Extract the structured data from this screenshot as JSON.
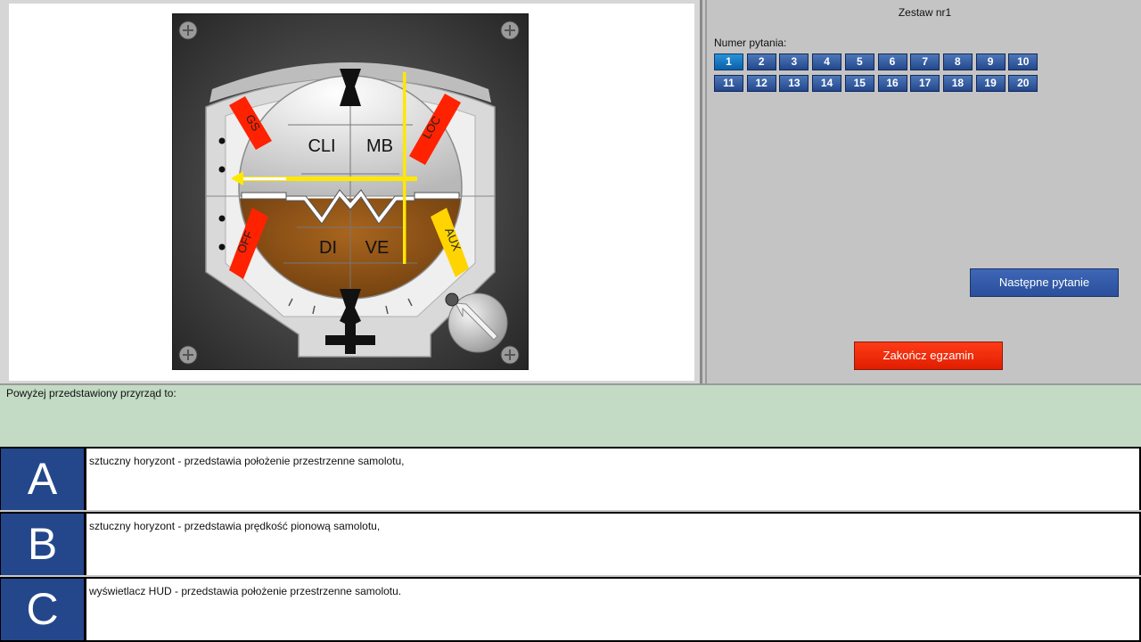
{
  "instrument": {
    "flags": {
      "gs": "GS",
      "loc": "LOC",
      "off": "OFF",
      "aux": "AUX"
    },
    "sky_label_left": "CLI",
    "sky_label_right": "MB",
    "ground_label_left": "DI",
    "ground_label_right": "VE",
    "colors": {
      "sky": "#e6e6e6",
      "ground": "#8a4e10",
      "bezel": "#3a3a3a",
      "flag_red": "#ff2200",
      "flag_yellow": "#ffd400",
      "bar_yellow": "#ffe800"
    }
  },
  "header": {
    "set_title": "Zestaw nr1"
  },
  "question_nav": {
    "label": "Numer pytania:",
    "active": "1",
    "numbers": [
      "1",
      "2",
      "3",
      "4",
      "5",
      "6",
      "7",
      "8",
      "9",
      "10",
      "11",
      "12",
      "13",
      "14",
      "15",
      "16",
      "17",
      "18",
      "19",
      "20"
    ]
  },
  "buttons": {
    "next": "Następne pytanie",
    "end": "Zakończ egzamin"
  },
  "question": {
    "text": "Powyżej przedstawiony przyrząd to:"
  },
  "answers": [
    {
      "letter": "A",
      "text": "sztuczny horyzont - przedstawia położenie przestrzenne samolotu,"
    },
    {
      "letter": "B",
      "text": "sztuczny horyzont - przedstawia prędkość pionową samolotu,"
    },
    {
      "letter": "C",
      "text": "wyświetlacz HUD - przedstawia położenie przestrzenne samolotu."
    }
  ],
  "colors": {
    "button_blue": "#2a4f9c",
    "button_red": "#ff2a0a",
    "question_bg": "#c3dbc4"
  }
}
